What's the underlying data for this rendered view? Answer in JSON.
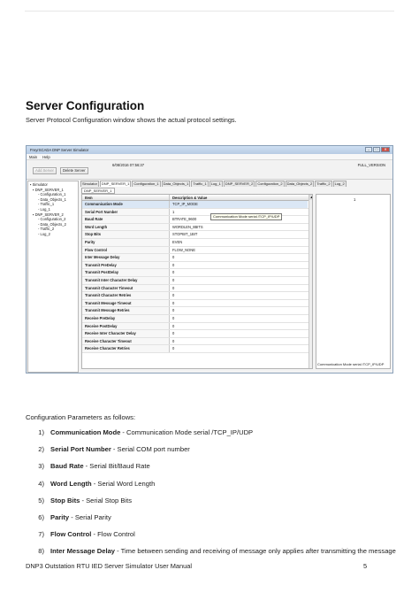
{
  "heading": "Server Configuration",
  "intro": "Server Protocol Configuration window shows the actual protocol settings.",
  "screenshot": {
    "window_title": "FreyrSCADA DNP Server Simulator",
    "menu": [
      "Main",
      "Help"
    ],
    "toolbar": {
      "add_server": "Add Server",
      "delete_server": "Delete Server",
      "datetime": "6/08/2016 07:56:37",
      "version": "FULL_VERSION"
    },
    "tree": [
      "Simulator",
      "DNP_SERVER_1",
      "Configuration_1",
      "Data_Objects_1",
      "Traffic_1",
      "Log_1",
      "DNP_SERVER_2",
      "Configuration_2",
      "Data_Objects_2",
      "Traffic_2",
      "Log_2"
    ],
    "tabs": [
      "Simulator",
      "DNP_SERVER_1",
      "Configuration_1",
      "Data_Objects_1",
      "Traffic_1",
      "Log_1",
      "DNP_SERVER_2",
      "Configuration_2",
      "Data_Objects_2",
      "Traffic_2",
      "Log_2"
    ],
    "subtab": "DNP_SERVER_1",
    "grid_headers": [
      "Item",
      "Description & Value"
    ],
    "grid_rows": [
      {
        "item": "Communication Mode",
        "value": "TCP_IP_MODE"
      },
      {
        "item": "Serial Port Number",
        "value": "1"
      },
      {
        "item": "Baud Rate",
        "value": "BTRATE_9600"
      },
      {
        "item": "Word Length",
        "value": "WORDLEN_8BITS"
      },
      {
        "item": "Stop Bits",
        "value": "STOPBIT_1BIT"
      },
      {
        "item": "Parity",
        "value": "EVEN"
      },
      {
        "item": "Flow Control",
        "value": "FLOW_NONE"
      },
      {
        "item": "Inter Message Delay",
        "value": "0"
      },
      {
        "item": "Transmit PreDelay",
        "value": "0"
      },
      {
        "item": "Transmit PostDelay",
        "value": "0"
      },
      {
        "item": "Transmit Inter Character Delay",
        "value": "0"
      },
      {
        "item": "Transmit Character Timeout",
        "value": "0"
      },
      {
        "item": "Transmit Character Retries",
        "value": "0"
      },
      {
        "item": "Transmit Message Timeout",
        "value": "0"
      },
      {
        "item": "Transmit Message Retries",
        "value": "0"
      },
      {
        "item": "Receive PreDelay",
        "value": "0"
      },
      {
        "item": "Receive PostDelay",
        "value": "0"
      },
      {
        "item": "Receive Inter Character Delay",
        "value": "0"
      },
      {
        "item": "Receive Character Timeout",
        "value": "0"
      },
      {
        "item": "Receive Character Retries",
        "value": "0"
      }
    ],
    "tooltip": "Communication Mode serial /TCP_IP/UDP",
    "detail_value": "1",
    "detail_description": "Communication Mode serial /TCP_IP/UDP"
  },
  "params_intro": "Configuration Parameters as follows:",
  "params": [
    {
      "num": "1)",
      "term": "Communication Mode",
      "desc": " - Communication Mode serial /TCP_IP/UDP"
    },
    {
      "num": "2)",
      "term": "Serial Port Number",
      "desc": " - Serial COM port number"
    },
    {
      "num": "3)",
      "term": "Baud Rate",
      "desc": " - Serial Bit/Baud Rate"
    },
    {
      "num": "4)",
      "term": "Word Length",
      "desc": " - Serial Word Length"
    },
    {
      "num": "5)",
      "term": "Stop Bits",
      "desc": " - Serial Stop Bits"
    },
    {
      "num": "6)",
      "term": "Parity",
      "desc": " - Serial Parity"
    },
    {
      "num": "7)",
      "term": "Flow Control",
      "desc": " - Flow Control"
    },
    {
      "num": "8)",
      "term": "Inter Message Delay",
      "desc": " - Time between sending and receiving of message only applies after transmitting the message"
    }
  ],
  "footer": {
    "title": "DNP3 Outstation RTU IED Server Simulator User Manual",
    "page": "5"
  }
}
